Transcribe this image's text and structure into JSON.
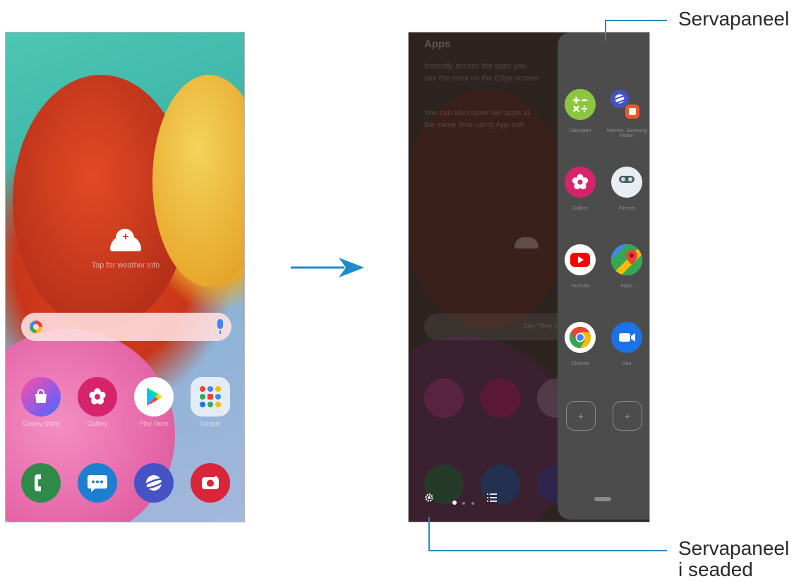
{
  "left_screen": {
    "weather_hint": "Tap for weather info",
    "apps_row": [
      {
        "label": "Galaxy Store",
        "icon": "shopping-bag-icon"
      },
      {
        "label": "Gallery",
        "icon": "gallery-flower-icon"
      },
      {
        "label": "Play Store",
        "icon": "play-store-icon"
      },
      {
        "label": "Google",
        "icon": "google-folder-icon"
      }
    ],
    "dock": [
      {
        "icon": "phone-icon",
        "color": "#2f8a4a"
      },
      {
        "icon": "messages-icon",
        "color": "#1e7fd0"
      },
      {
        "icon": "internet-icon",
        "color": "#4553c4"
      },
      {
        "icon": "camera-icon",
        "color": "#d9253a"
      }
    ]
  },
  "right_screen": {
    "panel_title": "Apps",
    "description_1": "Instantly access the apps you use the most on the Edge screen.",
    "description_2": "You can also open two apps at the same time using App pair.",
    "search_hint": "Say \"Hey Google\"",
    "edge_apps": [
      {
        "label": "Calculator",
        "icon": "calculator-icon",
        "color": "#8cc63f"
      },
      {
        "label": "Internet, Samsung Notes",
        "icon": "app-pair-icon",
        "color": "#4553c4"
      },
      {
        "label": "Gallery",
        "icon": "gallery-flower-icon",
        "color": "#d6246c"
      },
      {
        "label": "Friends",
        "icon": "friends-icon",
        "color": "#e8eef3"
      },
      {
        "label": "YouTube",
        "icon": "youtube-icon",
        "color": "#ff0000"
      },
      {
        "label": "Maps",
        "icon": "maps-icon",
        "color": "#34a853"
      },
      {
        "label": "Chrome",
        "icon": "chrome-icon",
        "color": "#ffffff"
      },
      {
        "label": "Duo",
        "icon": "duo-icon",
        "color": "#1a73e8"
      }
    ],
    "add_slots": [
      "+",
      "+"
    ]
  },
  "callouts": {
    "edge_panel": "Servapaneel",
    "settings_line1": "Servapaneel",
    "settings_line2": "i seaded"
  },
  "colors": {
    "accent": "#1d8bcc",
    "panel_bg": "#4c4c4c",
    "dimmed_bg": "#2d2421"
  }
}
